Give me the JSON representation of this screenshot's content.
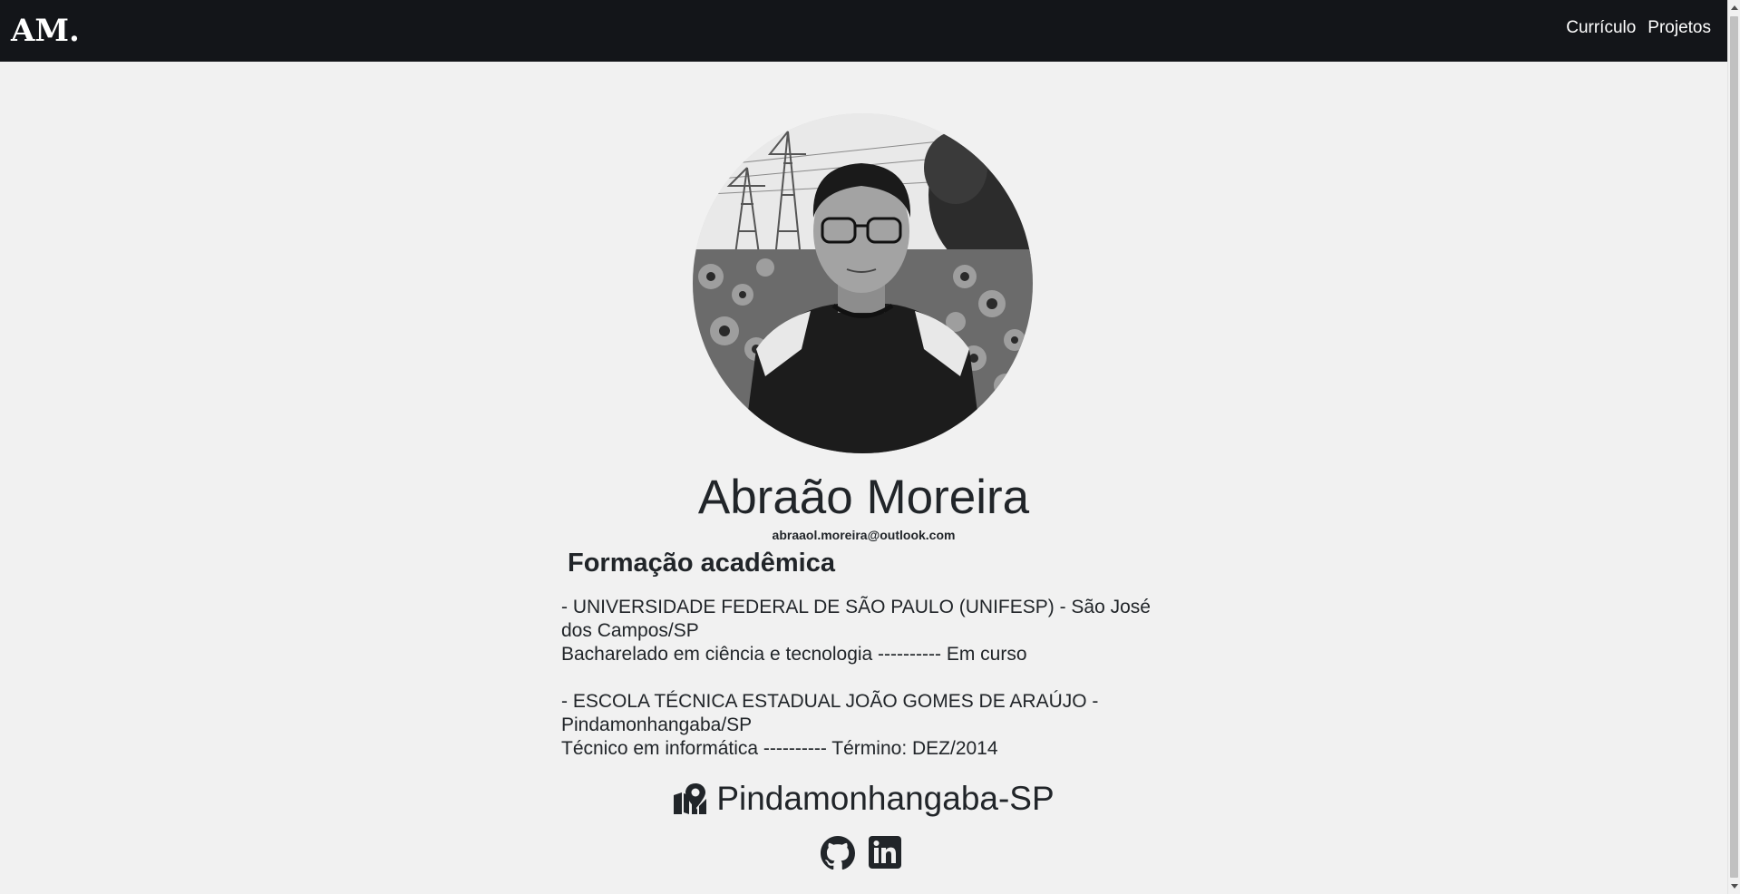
{
  "navbar": {
    "brand": "AM.",
    "links": [
      {
        "label": "Currículo"
      },
      {
        "label": "Projetos"
      }
    ]
  },
  "profile": {
    "name": "Abraão Moreira",
    "email": "abraaol.moreira@outlook.com"
  },
  "education": {
    "title": "Formação acadêmica",
    "entries": [
      {
        "institution": "- UNIVERSIDADE FEDERAL DE SÃO PAULO (UNIFESP) - São José dos Campos/SP",
        "course": "Bacharelado em ciência e tecnologia ---------- Em curso"
      },
      {
        "institution": "- ESCOLA TÉCNICA ESTADUAL JOÃO GOMES DE ARAÚJO - Pindamonhangaba/SP",
        "course": "Técnico em informática ---------- Término: DEZ/2014"
      }
    ]
  },
  "location": {
    "icon": "map-marker-icon",
    "text": "Pindamonhangaba-SP"
  },
  "socials": [
    {
      "icon": "github-icon"
    },
    {
      "icon": "linkedin-icon"
    }
  ],
  "colors": {
    "navbar_bg": "#131519",
    "page_bg": "#f1f1f1",
    "text": "#212529"
  }
}
